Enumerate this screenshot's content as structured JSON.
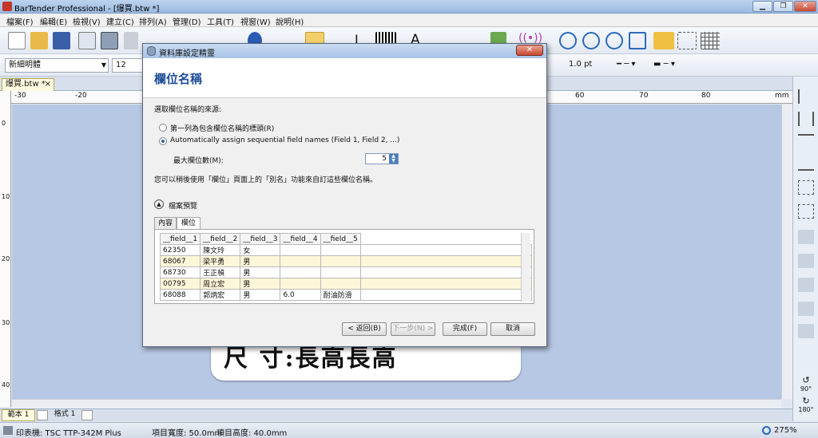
{
  "window": {
    "title": "BarTender Professional - [爆買.btw *]"
  },
  "menu": [
    "檔案(F)",
    "編輯(E)",
    "檢視(V)",
    "建立(C)",
    "排列(A)",
    "管理(D)",
    "工具(T)",
    "視窗(W)",
    "說明(H)"
  ],
  "format_toolbar": {
    "font": "新細明體",
    "size": "12",
    "line_weight": "1.0 pt"
  },
  "document_tab": {
    "label": "爆買.btw *",
    "close": "×"
  },
  "ruler": {
    "top_ticks": [
      "-30",
      "-20",
      "60",
      "70",
      "80",
      "mm"
    ],
    "left_ticks": [
      "0",
      "10",
      "20",
      "30",
      "40"
    ]
  },
  "label_preview": {
    "text": "尺   寸:長高長高"
  },
  "right_panel": {
    "rotate_90": "90°",
    "rotate_180": "180°"
  },
  "page_tabs": [
    {
      "label": "範本 1"
    },
    {
      "label": "格式 1"
    }
  ],
  "status": {
    "printer": "印表機: TSC TTP-342M Plus",
    "width": "項目寬度: 50.0mm",
    "height": "項目高度: 40.0mm",
    "zoom": "275%"
  },
  "dialog": {
    "title": "資料庫設定精靈",
    "heading": "欄位名稱",
    "source_prompt": "選取欄位名稱的來源:",
    "option1": "第一列為包含欄位名稱的標頭(R)",
    "option2": "Automatically assign sequential field names (Field 1, Field 2, ...)",
    "max_fields_label": "最大欄位數(M):",
    "max_fields_value": "5",
    "note": "您可以稍後使用「欄位」頁面上的「別名」功能來自訂這些欄位名稱。",
    "preview_label": "檔案預覽",
    "tabs": [
      "內容",
      "欄位"
    ],
    "columns": [
      "__field__1",
      "__field__2",
      "__field__3",
      "__field__4",
      "__field__5"
    ],
    "rows": [
      [
        "62350",
        "陳文玲",
        "女",
        "",
        ""
      ],
      [
        "68067",
        "梁平勇",
        "男",
        "",
        ""
      ],
      [
        "68730",
        "王正楨",
        "男",
        "",
        ""
      ],
      [
        "00795",
        "周立宏",
        "男",
        "",
        ""
      ],
      [
        "68088",
        "郭炳宏",
        "男",
        "6.0",
        "耐油防滑"
      ]
    ],
    "buttons": {
      "back": "< 返回(B)",
      "next": "下一步(N) >",
      "finish": "完成(F)",
      "cancel": "取消"
    }
  }
}
